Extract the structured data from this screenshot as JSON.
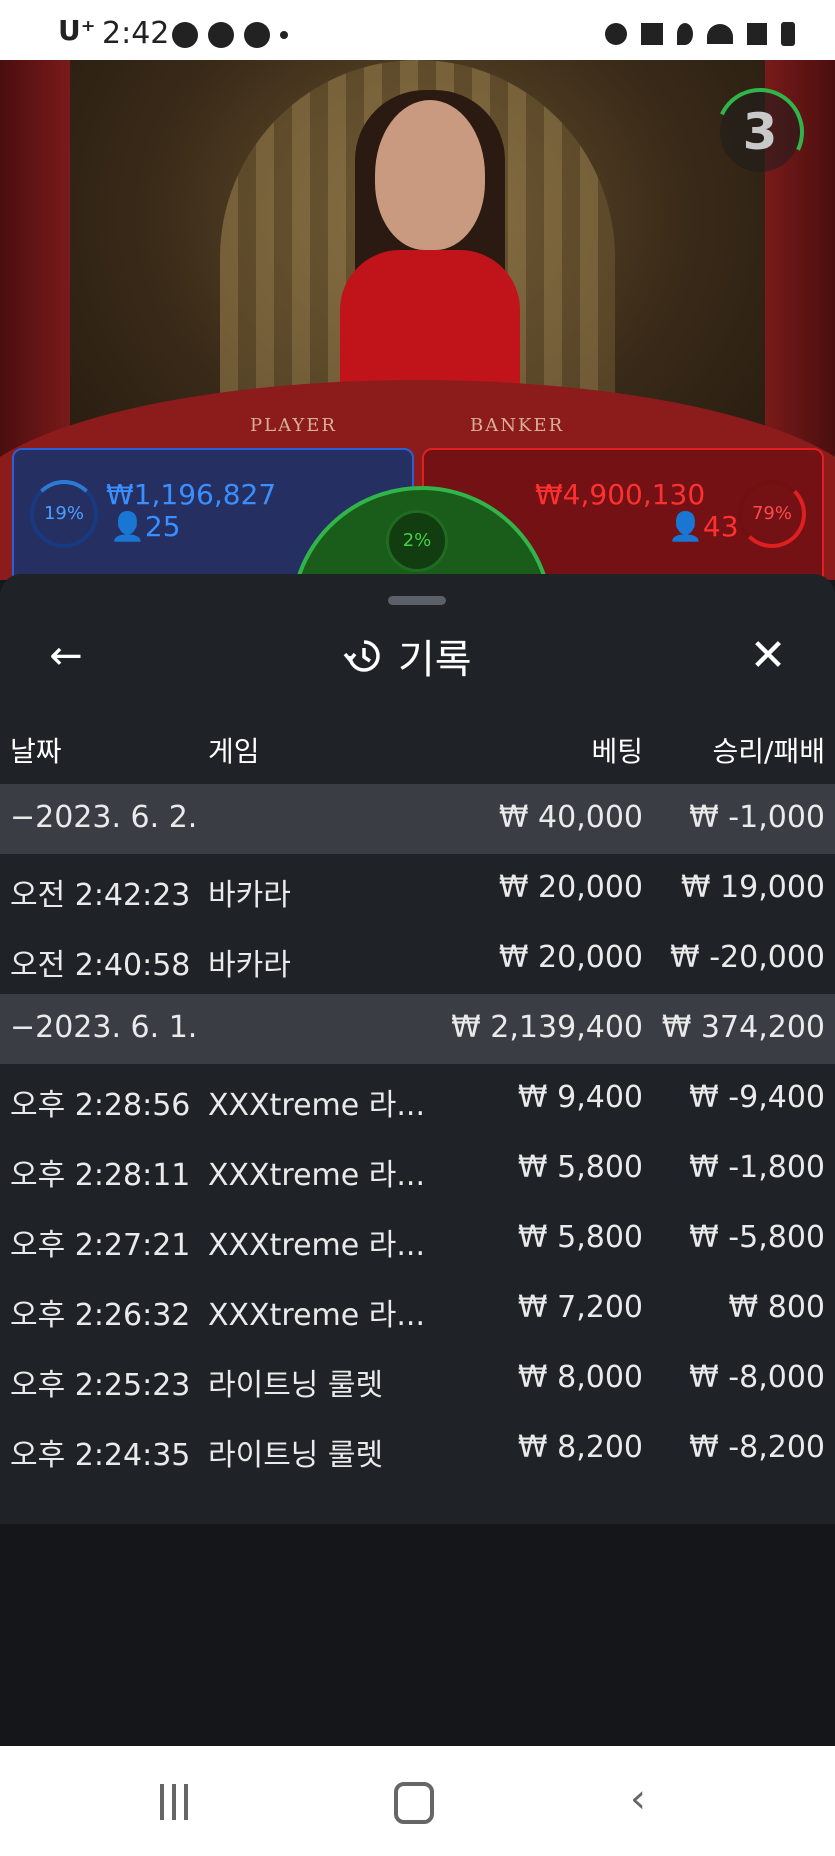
{
  "status_bar": {
    "carrier": "U⁺",
    "time": "2:42"
  },
  "video": {
    "timer": "3",
    "table_labels": {
      "player": "PLAYER",
      "banker": "BANKER"
    }
  },
  "bets": {
    "player": {
      "percent": "19%",
      "amount": "₩1,196,827",
      "count": "25"
    },
    "banker": {
      "percent": "79%",
      "amount": "₩4,900,130",
      "count": "43"
    },
    "tie": {
      "percent": "2%"
    }
  },
  "sheet": {
    "title": "기록",
    "back_icon": "←",
    "close_icon": "✕",
    "columns": {
      "date": "날짜",
      "game": "게임",
      "bet": "베팅",
      "result": "승리/패배"
    },
    "rows": [
      {
        "date": "−2023. 6. 2.",
        "game": "",
        "bet": "₩ 40,000",
        "result": "₩ -1,000",
        "group": true
      },
      {
        "date": "오전 2:42:23",
        "game": "바카라",
        "bet": "₩ 20,000",
        "result": "₩ 19,000"
      },
      {
        "date": "오전 2:40:58",
        "game": "바카라",
        "bet": "₩ 20,000",
        "result": "₩ -20,000"
      },
      {
        "date": "−2023. 6. 1.",
        "game": "",
        "bet": "₩ 2,139,400",
        "result": "₩ 374,200",
        "group": true
      },
      {
        "date": "오후 2:28:56",
        "game": "XXXtreme 라...",
        "bet": "₩ 9,400",
        "result": "₩ -9,400"
      },
      {
        "date": "오후 2:28:11",
        "game": "XXXtreme 라...",
        "bet": "₩ 5,800",
        "result": "₩ -1,800"
      },
      {
        "date": "오후 2:27:21",
        "game": "XXXtreme 라...",
        "bet": "₩ 5,800",
        "result": "₩ -5,800"
      },
      {
        "date": "오후 2:26:32",
        "game": "XXXtreme 라...",
        "bet": "₩ 7,200",
        "result": "₩ 800"
      },
      {
        "date": "오후 2:25:23",
        "game": "라이트닝 룰렛",
        "bet": "₩ 8,000",
        "result": "₩ -8,000"
      },
      {
        "date": "오후 2:24:35",
        "game": "라이트닝 룰렛",
        "bet": "₩ 8,200",
        "result": "₩ -8,200"
      }
    ]
  },
  "colors": {
    "player_blue": "#2a5fd6",
    "banker_red": "#e02020",
    "tie_green": "#2fb54a",
    "sheet_bg": "#1f2227",
    "group_row_bg": "#3a3d43"
  }
}
